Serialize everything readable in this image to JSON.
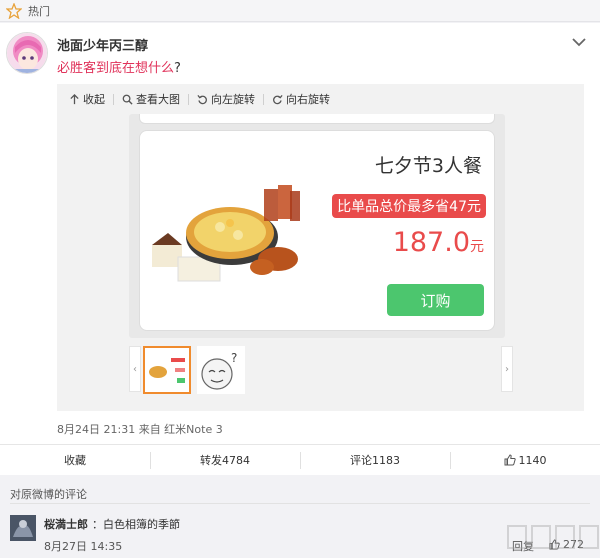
{
  "topbar": {
    "label": "热门",
    "icon": "star-outline-icon"
  },
  "post": {
    "username": "池面少年丙三醇",
    "text_red": "必胜客到底在想什么",
    "text_tail": "?",
    "meta": "8月24日 21:31 来自 红米Note 3",
    "accent": "#e0325a"
  },
  "toolbar": {
    "collapse": "收起",
    "view_large": "查看大图",
    "rotate_left": "向左旋转",
    "rotate_right": "向右旋转"
  },
  "promo": {
    "title": "七夕节3人餐",
    "badge": "比单品总价最多省47元",
    "price": "187.0",
    "unit": "元",
    "buy": "订购",
    "badge_color": "#e94b4b",
    "buy_color": "#4cc66e"
  },
  "actions": {
    "favorite": "收藏",
    "repost": "转发4784",
    "comment": "评论1183",
    "like": "1140"
  },
  "comments": {
    "header": "对原微博的评论",
    "items": [
      {
        "name": "桜満士郎",
        "text": "：白色相簿的季節",
        "time": "8月27日 14:35",
        "reply": "回复",
        "likes": "272"
      }
    ]
  }
}
